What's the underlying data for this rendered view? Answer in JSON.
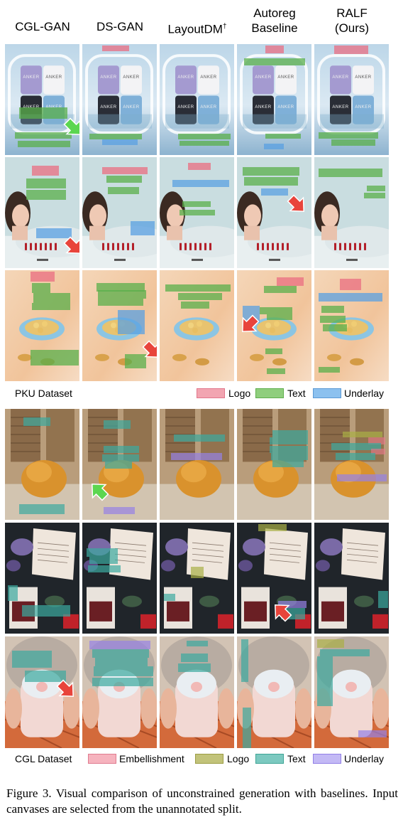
{
  "methods": [
    "CGL-GAN",
    "DS-GAN",
    "LayoutDM",
    "Autoreg Baseline",
    "RALF (Ours)"
  ],
  "method_headers": [
    {
      "line1": "CGL-GAN",
      "line2": ""
    },
    {
      "line1": "DS-GAN",
      "line2": ""
    },
    {
      "line1": "LayoutDM",
      "sup": "†",
      "line2": ""
    },
    {
      "line1": "Autoreg",
      "line2": "Baseline"
    },
    {
      "line1": "RALF",
      "line2": "(Ours)"
    }
  ],
  "pku_legend": {
    "dataset": "PKU Dataset",
    "items": [
      {
        "label": "Logo",
        "color": "#e9798c"
      },
      {
        "label": "Text",
        "color": "#6bb85a"
      },
      {
        "label": "Underlay",
        "color": "#6aa8e0"
      }
    ]
  },
  "cgl_legend": {
    "dataset": "CGL Dataset",
    "items": [
      {
        "label": "Embellishment",
        "color": "#ef97a6"
      },
      {
        "label": "Logo",
        "color": "#b6b860"
      },
      {
        "label": "Text",
        "color": "#5cb7ad"
      },
      {
        "label": "Underlay",
        "color": "#a99bf0"
      }
    ]
  },
  "product_brand": "ANKER",
  "caption": {
    "label": "Figure 3.",
    "text": "Visual comparison of unconstrained generation with baselines. Input canvases are selected from the unannotated split."
  }
}
